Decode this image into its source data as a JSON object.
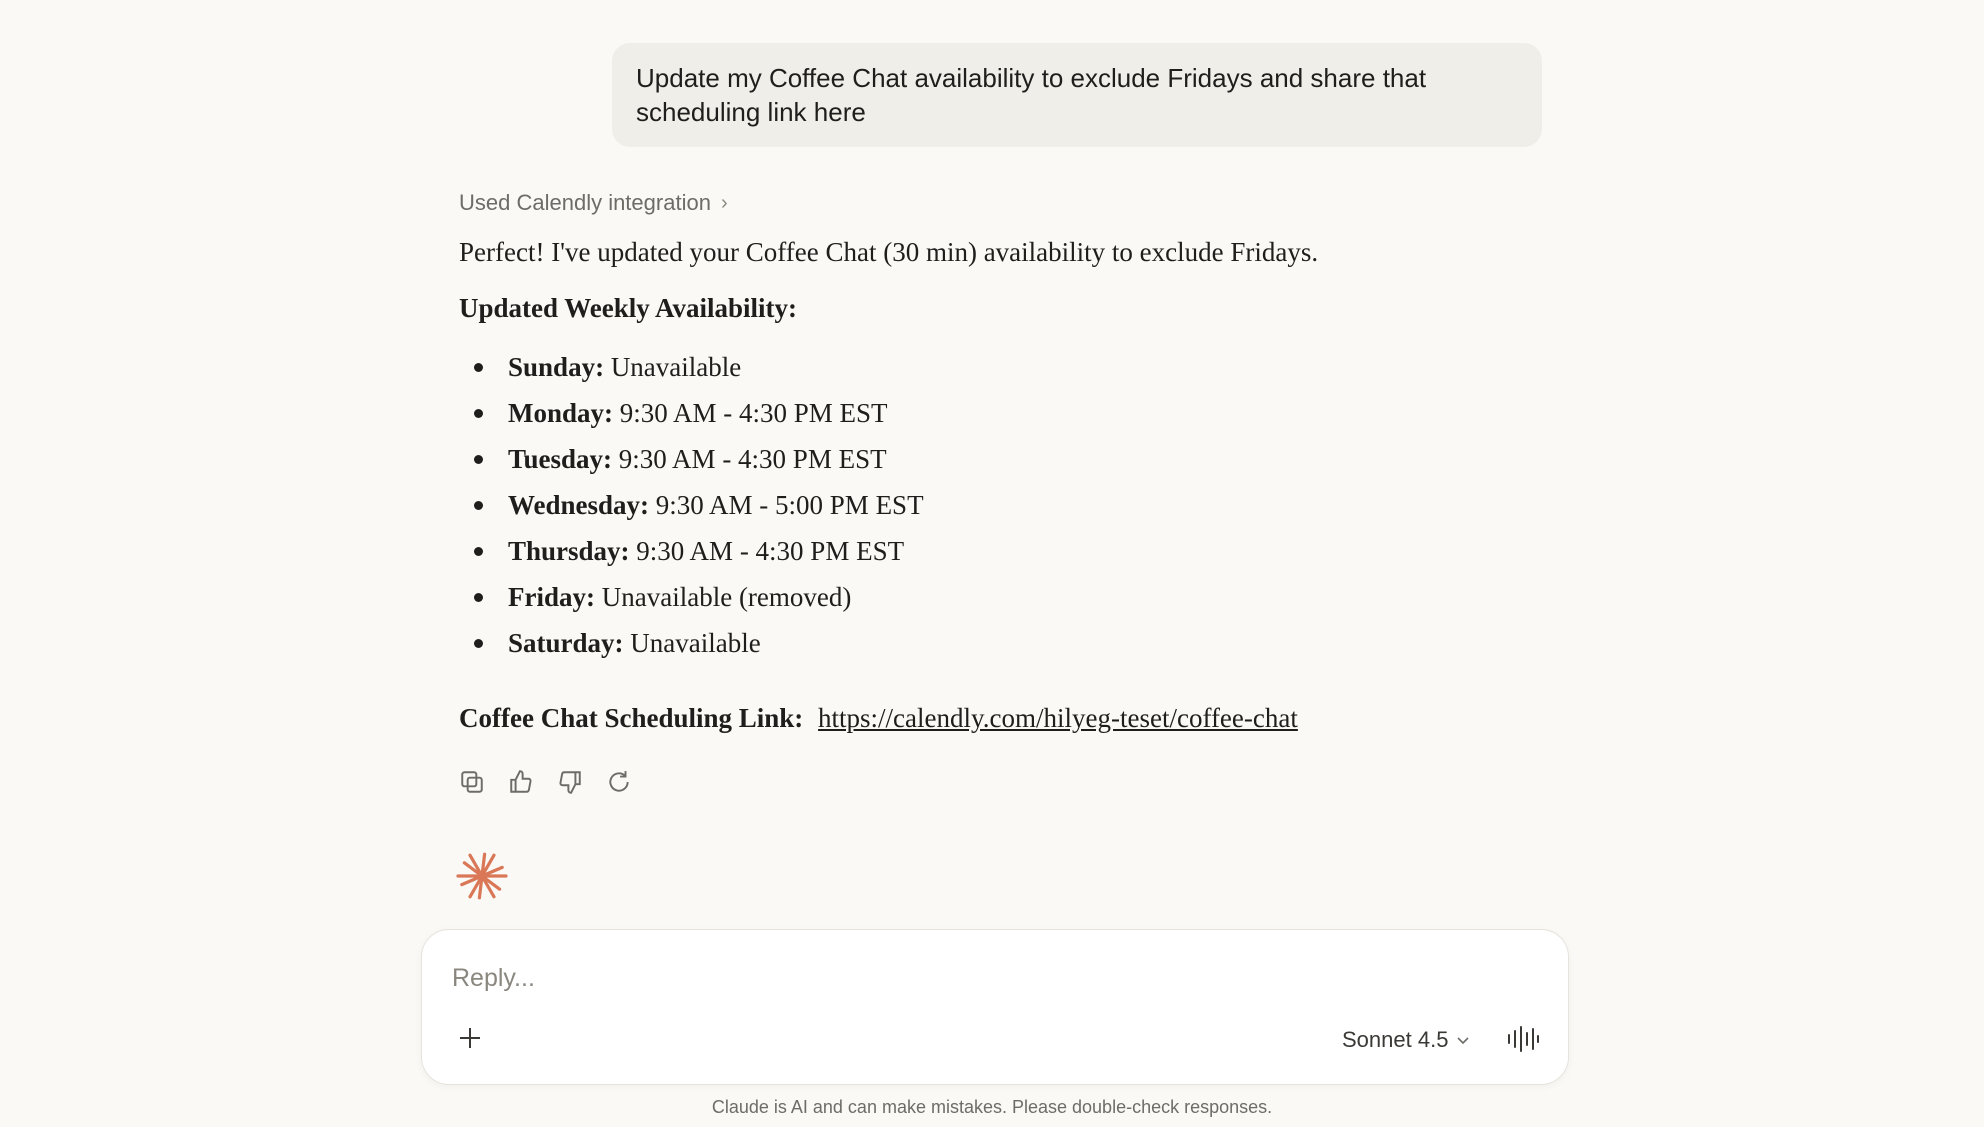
{
  "user_message": "Update my Coffee Chat availability to exclude Fridays and share that scheduling link here",
  "integration_label": "Used Calendly integration",
  "response": {
    "intro": "Perfect! I've updated your Coffee Chat (30 min) availability to exclude Fridays.",
    "heading": "Updated Weekly Availability:",
    "availability": [
      {
        "day": "Sunday:",
        "hours": "Unavailable"
      },
      {
        "day": "Monday:",
        "hours": "9:30 AM - 4:30 PM EST"
      },
      {
        "day": "Tuesday:",
        "hours": "9:30 AM - 4:30 PM EST"
      },
      {
        "day": "Wednesday:",
        "hours": "9:30 AM - 5:00 PM EST"
      },
      {
        "day": "Thursday:",
        "hours": "9:30 AM - 4:30 PM EST"
      },
      {
        "day": "Friday:",
        "hours": "Unavailable (removed)"
      },
      {
        "day": "Saturday:",
        "hours": "Unavailable"
      }
    ],
    "link_label": "Coffee Chat Scheduling Link:",
    "link_url": "https://calendly.com/hilyeg-teset/coffee-chat"
  },
  "actions": [
    "copy-icon",
    "thumbs-up-icon",
    "thumbs-down-icon",
    "retry-icon"
  ],
  "composer": {
    "placeholder": "Reply...",
    "model": "Sonnet 4.5"
  },
  "disclaimer": "Claude is AI and can make mistakes. Please double-check responses.",
  "colors": {
    "background": "#faf9f6",
    "bubble": "#f0eee8",
    "accent": "#d97757"
  }
}
